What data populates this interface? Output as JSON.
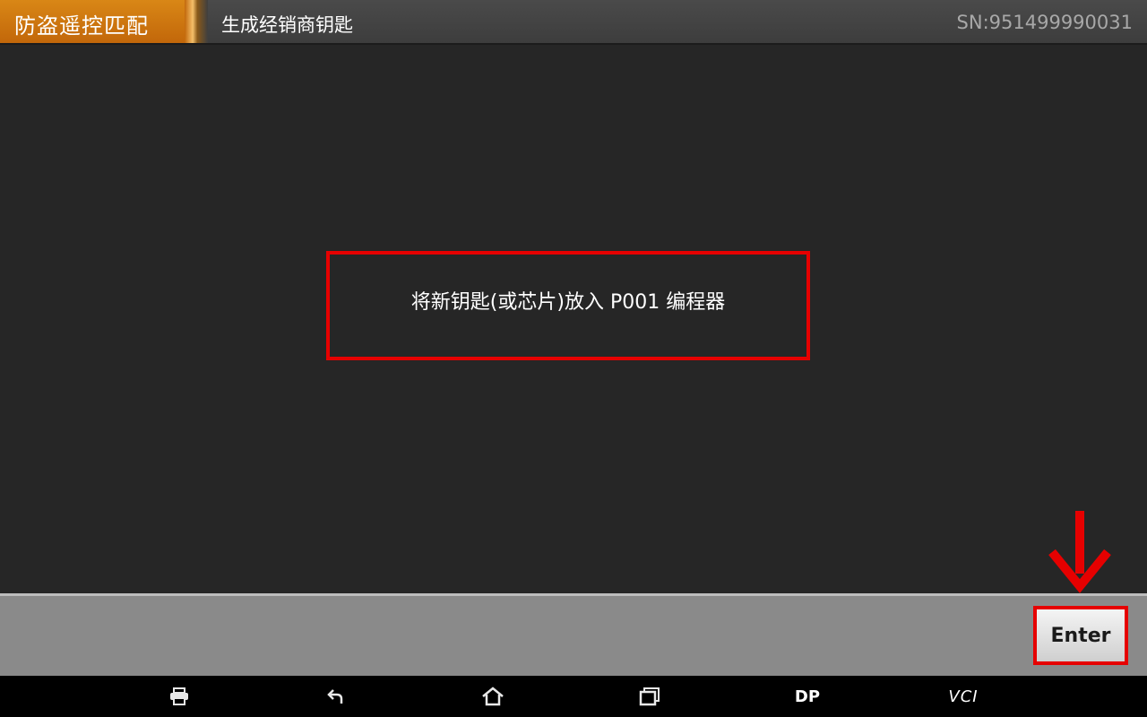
{
  "header": {
    "menu_label": "防盗遥控匹配",
    "page_title": "生成经销商钥匙",
    "serial": "SN:951499990031"
  },
  "main": {
    "message": "将新钥匙(或芯片)放入 P001 编程器"
  },
  "footer": {
    "enter_label": "Enter"
  },
  "navbar": {
    "icons": [
      "printer-icon",
      "back-icon",
      "home-icon",
      "recent-apps-icon"
    ],
    "dp_label": "DP",
    "vci_label": "VCI"
  },
  "colors": {
    "header_tab": "#c96f0e",
    "highlight_red": "#e60000",
    "background": "#262626",
    "footer": "#8a8a8a"
  }
}
